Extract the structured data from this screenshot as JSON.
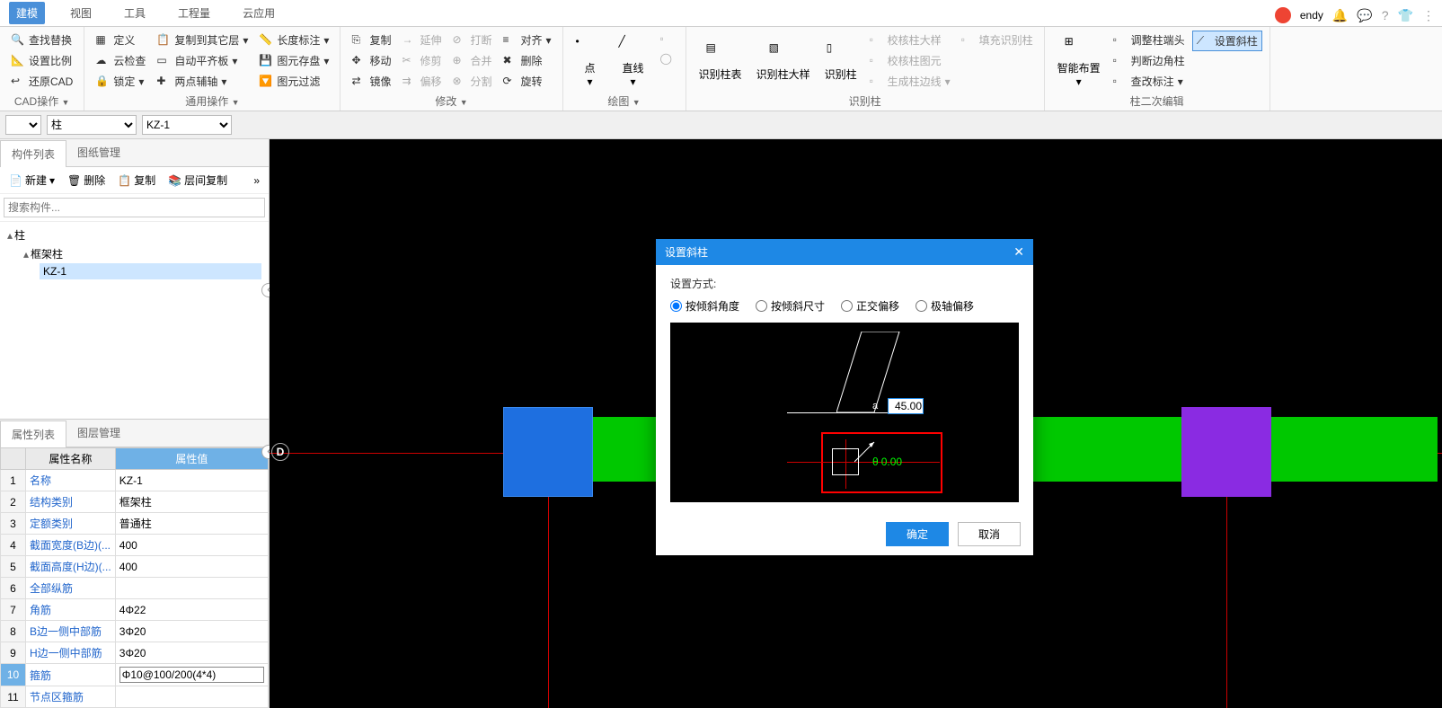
{
  "user": {
    "name": "endy"
  },
  "tabs": {
    "t0": "建模",
    "t1": "视图",
    "t2": "工具",
    "t3": "工程量",
    "t4": "云应用"
  },
  "ribbon": {
    "cad": {
      "find_replace": "查找替换",
      "set_scale": "设置比例",
      "restore_cad": "还原CAD",
      "label": "CAD操作"
    },
    "general": {
      "define": "定义",
      "cloud_check": "云检查",
      "lock": "锁定",
      "copy_others": "复制到其它层",
      "auto_flat": "自动平齐板",
      "two_point": "两点辅轴",
      "length_annot": "长度标注",
      "image_save": "图元存盘",
      "image_filter": "图元过滤",
      "label": "通用操作"
    },
    "modify": {
      "copy": "复制",
      "move": "移动",
      "mirror": "镜像",
      "extend": "延伸",
      "trim": "修剪",
      "offset": "偏移",
      "break": "打断",
      "merge": "合并",
      "split": "分割",
      "align": "对齐",
      "delete": "删除",
      "rotate": "旋转",
      "label": "修改"
    },
    "draw": {
      "point": "点",
      "line": "直线",
      "label": "绘图"
    },
    "recognize": {
      "col_table": "识别柱表",
      "big_table": "识别柱大样",
      "col": "识别柱",
      "check_big": "校核柱大样",
      "check_img": "校核柱图元",
      "gen_edge": "生成柱边线",
      "fill": "填充识别柱",
      "label": "识别柱"
    },
    "col_edit": {
      "smart": "智能布置",
      "adjust_end": "调整柱端头",
      "judge_corner": "判断边角柱",
      "check_annot": "查改标注",
      "set_inclined": "设置斜柱",
      "label": "柱二次编辑"
    }
  },
  "subbar": {
    "sel1": "",
    "sel2": "柱",
    "sel3": "KZ-1"
  },
  "left": {
    "tabs": {
      "components": "构件列表",
      "drawings": "图纸管理"
    },
    "toolbar": {
      "new": "新建",
      "delete": "删除",
      "copy": "复制",
      "layer_copy": "层间复制"
    },
    "search_ph": "搜索构件...",
    "tree": {
      "root": "柱",
      "child": "框架柱",
      "leaf": "KZ-1"
    },
    "prop_tabs": {
      "props": "属性列表",
      "layers": "图层管理"
    },
    "prop_headers": {
      "name": "属性名称",
      "val": "属性值"
    },
    "props": [
      {
        "idx": "1",
        "name": "名称",
        "val": "KZ-1"
      },
      {
        "idx": "2",
        "name": "结构类别",
        "val": "框架柱"
      },
      {
        "idx": "3",
        "name": "定额类别",
        "val": "普通柱"
      },
      {
        "idx": "4",
        "name": "截面宽度(B边)(...",
        "val": "400"
      },
      {
        "idx": "5",
        "name": "截面高度(H边)(...",
        "val": "400"
      },
      {
        "idx": "6",
        "name": "全部纵筋",
        "val": ""
      },
      {
        "idx": "7",
        "name": "角筋",
        "val": "4Φ22"
      },
      {
        "idx": "8",
        "name": "B边一侧中部筋",
        "val": "3Φ20"
      },
      {
        "idx": "9",
        "name": "H边一侧中部筋",
        "val": "3Φ20"
      },
      {
        "idx": "10",
        "name": "箍筋",
        "val": "Φ10@100/200(4*4)"
      },
      {
        "idx": "11",
        "name": "节点区箍筋",
        "val": ""
      }
    ]
  },
  "canvas": {
    "axis_d": "D"
  },
  "dialog": {
    "title": "设置斜柱",
    "group": "设置方式:",
    "r1": "按倾斜角度",
    "r2": "按倾斜尺寸",
    "r3": "正交偏移",
    "r4": "极轴偏移",
    "angle_letter": "a",
    "angle_val": "45.00",
    "theta_letter": "θ",
    "theta_val": "0.00",
    "ok": "确定",
    "cancel": "取消"
  }
}
